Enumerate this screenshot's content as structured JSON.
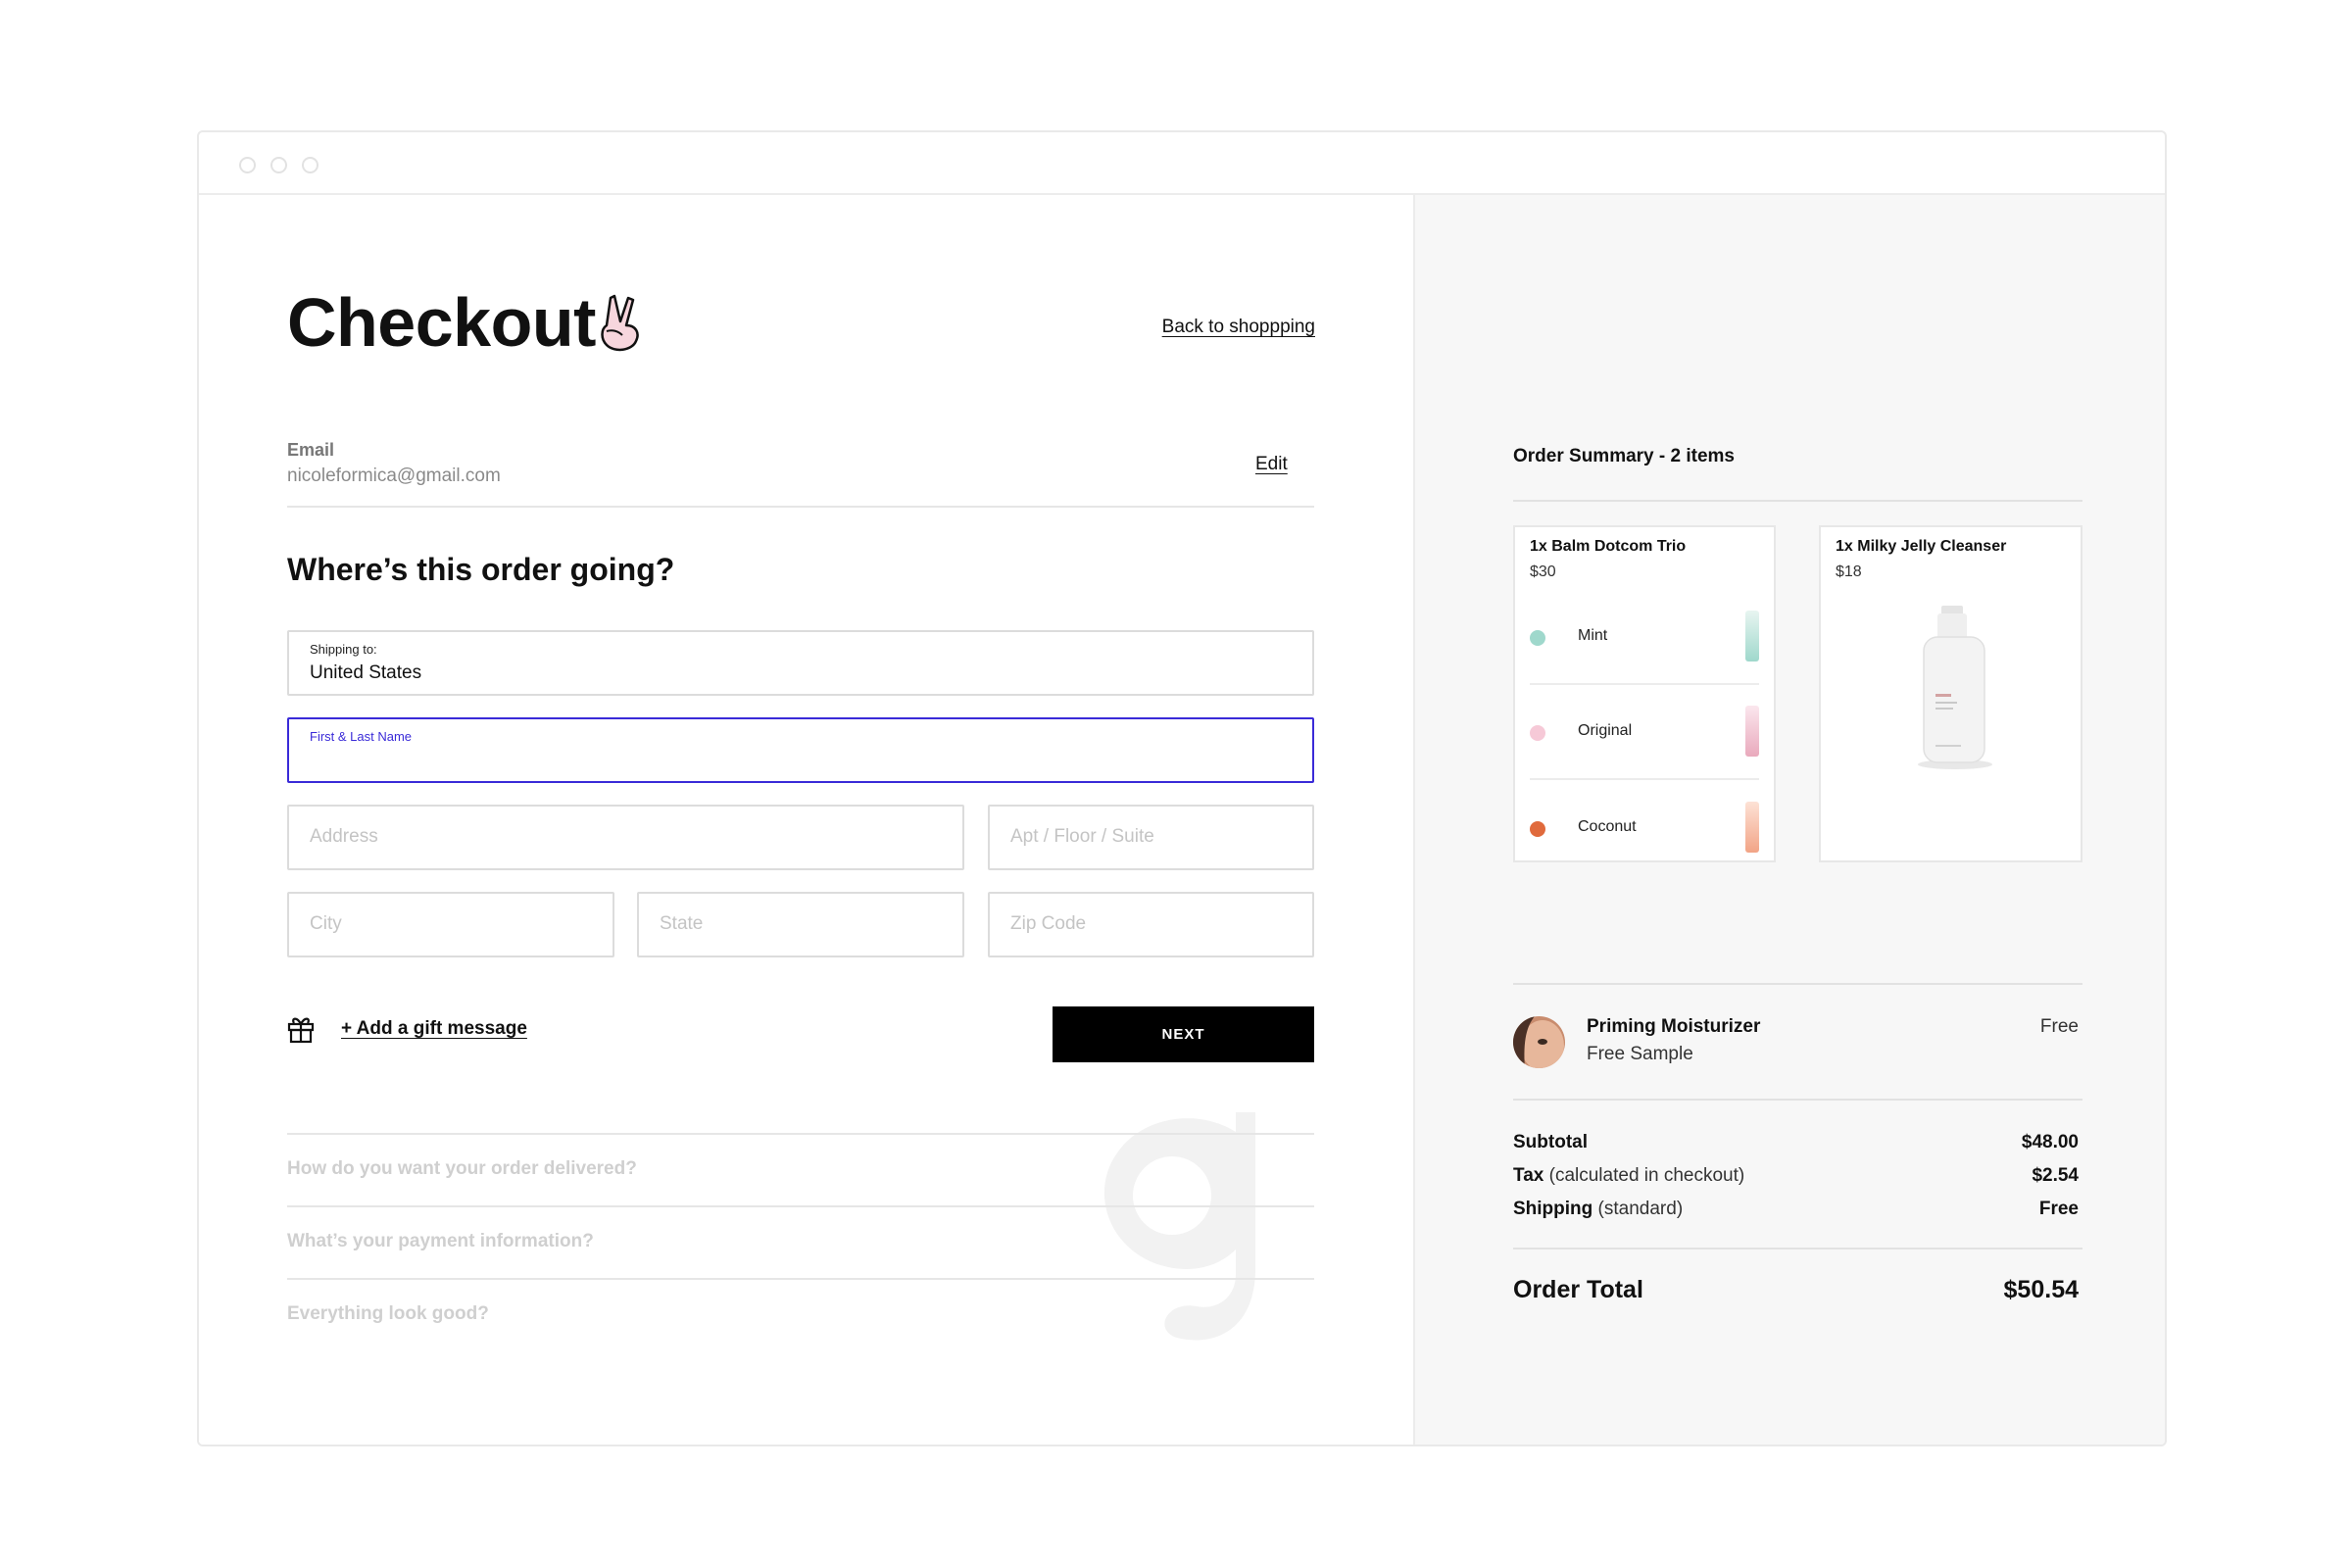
{
  "checkout": {
    "title": "Checkout",
    "back_link": "Back to shoppping",
    "email": {
      "label": "Email",
      "value": "nicoleformica@gmail.com",
      "edit_label": "Edit"
    },
    "section_heading": "Where’s this order going?",
    "shipping": {
      "label": "Shipping to:",
      "value": "United States"
    },
    "name_field": {
      "label": "First & Last Name",
      "value": ""
    },
    "address_placeholder": "Address",
    "apt_placeholder": "Apt / Floor / Suite",
    "city_placeholder": "City",
    "state_placeholder": "State",
    "zip_placeholder": "Zip Code",
    "gift_message_label": "+ Add a gift message",
    "next_label": "NEXT",
    "steps": [
      "How do you want your order delivered?",
      "What’s your payment information?",
      "Everything look good?"
    ],
    "accent_color": "#3a2bd8"
  },
  "summary": {
    "title": "Order Summary - 2 items",
    "items": [
      {
        "title": "1x Balm Dotcom Trio",
        "price": "$30",
        "variants": [
          {
            "label": "Mint",
            "color": "#9fd8cc"
          },
          {
            "label": "Original",
            "color": "#f6c9d7"
          },
          {
            "label": "Coconut",
            "color": "#e06a3c"
          }
        ]
      },
      {
        "title": "1x Milky Jelly Cleanser",
        "price": "$18"
      }
    ],
    "sample": {
      "name": "Priming Moisturizer",
      "sub": "Free Sample",
      "price": "Free"
    },
    "lines": [
      {
        "label": "Subtotal",
        "note": "",
        "value": "$48.00"
      },
      {
        "label": "Tax",
        "note": "(calculated in checkout)",
        "value": "$2.54"
      },
      {
        "label": "Shipping",
        "note": "(standard)",
        "value": "Free"
      }
    ],
    "total": {
      "label": "Order Total",
      "value": "$50.54"
    }
  }
}
